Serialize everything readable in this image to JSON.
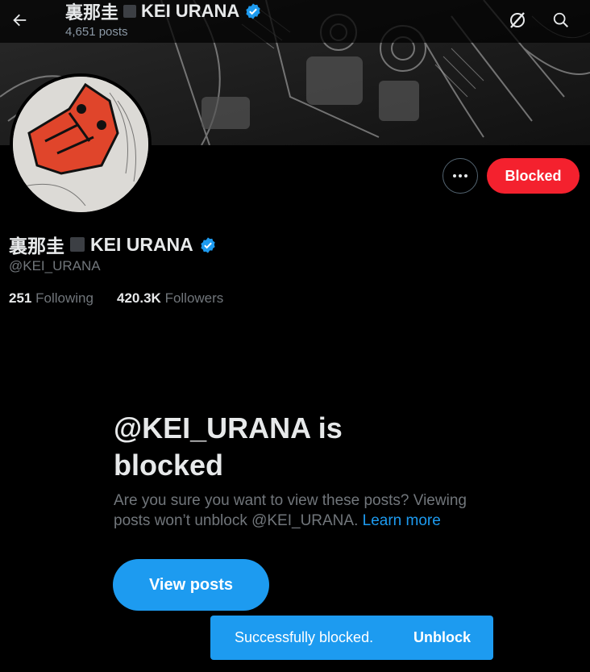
{
  "header": {
    "name_kanji": "裏那圭",
    "name_latin": "KEI URANA",
    "post_count": "4,651 posts"
  },
  "profile": {
    "name_kanji": "裏那圭",
    "name_latin": "KEI URANA",
    "handle": "@KEI_URANA",
    "following_count": "251",
    "following_label": "Following",
    "followers_count": "420.3K",
    "followers_label": "Followers",
    "blocked_button_label": "Blocked"
  },
  "blocked_notice": {
    "title": "@KEI_URANA is blocked",
    "description": "Are you sure you want to view these posts? Viewing posts won’t unblock @KEI_URANA.",
    "learn_more": "Learn more",
    "view_posts_label": "View posts"
  },
  "toast": {
    "message": "Successfully blocked.",
    "action": "Unblock"
  },
  "colors": {
    "background": "#000000",
    "accent": "#1d9bf0",
    "danger": "#f4212e",
    "secondary_text": "#71767b"
  },
  "icons": [
    "back-arrow-icon",
    "grok-icon",
    "search-icon",
    "verified-badge-icon",
    "more-icon"
  ]
}
